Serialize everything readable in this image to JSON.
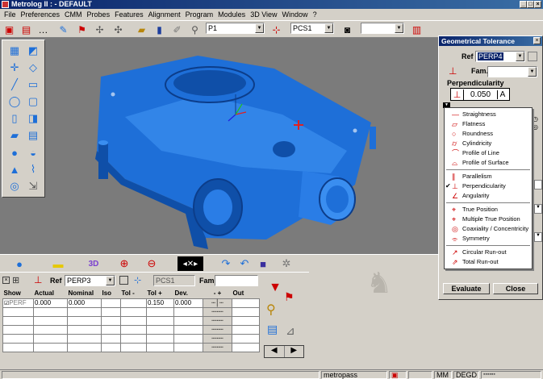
{
  "window": {
    "title": "Metrolog II : - DEFAULT"
  },
  "menu": [
    "File",
    "Preferences",
    "CMM",
    "Probes",
    "Features",
    "Alignment",
    "Program",
    "Modules",
    "3D View",
    "Window",
    "?"
  ],
  "toolbar": {
    "feature_combo": "P1",
    "pcs_combo": "PCS1",
    "extra_combo": ""
  },
  "geometrical_tolerance": {
    "title": "Geometrical Tolerance",
    "ref_label": "Ref",
    "ref_value": "PERP4",
    "fam_label": "Fam.",
    "fam_value": "",
    "type_label": "Perpendicularity",
    "tolerance_value": "0.050",
    "modifier": "A",
    "menu_items": [
      {
        "label": "Straightness",
        "icon": "straightness-icon",
        "glyph": "—"
      },
      {
        "label": "Flatness",
        "icon": "flatness-icon",
        "glyph": "▱"
      },
      {
        "label": "Roundness",
        "icon": "roundness-icon",
        "glyph": "○"
      },
      {
        "label": "Cylindricity",
        "icon": "cylindricity-icon",
        "glyph": "⌭"
      },
      {
        "label": "Profile of Line",
        "icon": "profile-line-icon",
        "glyph": "⌒"
      },
      {
        "label": "Profile of Surface",
        "icon": "profile-surface-icon",
        "glyph": "⌓"
      },
      {
        "label": "Parallelism",
        "icon": "parallelism-icon",
        "glyph": "∥"
      },
      {
        "label": "Perpendicularity",
        "icon": "perpendicularity-icon",
        "glyph": "⊥",
        "checked": true
      },
      {
        "label": "Angularity",
        "icon": "angularity-icon",
        "glyph": "∠"
      },
      {
        "label": "True Position",
        "icon": "true-position-icon",
        "glyph": "⌖"
      },
      {
        "label": "Multiple True Position",
        "icon": "multiple-true-position-icon",
        "glyph": "⌖"
      },
      {
        "label": "Coaxiality / Concentricity",
        "icon": "coaxiality-icon",
        "glyph": "◎"
      },
      {
        "label": "Symmetry",
        "icon": "symmetry-icon",
        "glyph": "⌯"
      },
      {
        "label": "Circular Run-out",
        "icon": "circular-runout-icon",
        "glyph": "↗"
      },
      {
        "label": "Total Run-out",
        "icon": "total-runout-icon",
        "glyph": "⇗"
      }
    ],
    "evaluate_label": "Evaluate",
    "close_label": "Close"
  },
  "results": {
    "ref_label": "Ref",
    "ref_value": "PERP3",
    "pcs_value": "PCS1",
    "fam_label": "Fam",
    "fam_value": "",
    "columns": [
      "Show",
      "Actual",
      "Nominal",
      "Iso",
      "Tol -",
      "Tol +",
      "Dev.",
      "-  +",
      "Out"
    ],
    "rows": [
      {
        "show": "PERF",
        "actual": "0.000",
        "nominal": "0.000",
        "iso": "",
        "tol_minus": "",
        "tol_plus": "0.150",
        "dev": "0.000",
        "out": ""
      },
      {
        "show": "",
        "actual": "",
        "nominal": "",
        "iso": "",
        "tol_minus": "",
        "tol_plus": "",
        "dev": "",
        "out": ""
      },
      {
        "show": "",
        "actual": "",
        "nominal": "",
        "iso": "",
        "tol_minus": "",
        "tol_plus": "",
        "dev": "",
        "out": ""
      },
      {
        "show": "",
        "actual": "",
        "nominal": "",
        "iso": "",
        "tol_minus": "",
        "tol_plus": "",
        "dev": "",
        "out": ""
      },
      {
        "show": "",
        "actual": "",
        "nominal": "",
        "iso": "",
        "tol_minus": "",
        "tol_plus": "",
        "dev": "",
        "out": ""
      },
      {
        "show": "",
        "actual": "",
        "nominal": "",
        "iso": "",
        "tol_minus": "",
        "tol_plus": "",
        "dev": "",
        "out": ""
      }
    ]
  },
  "status": {
    "user": "metropass",
    "units": "MM",
    "angle": "DEGD"
  },
  "colors": {
    "title_bar": "#0a246a",
    "part": "#1e6fd8",
    "viewport": "#7b7b7b",
    "marker": "#e02020"
  }
}
